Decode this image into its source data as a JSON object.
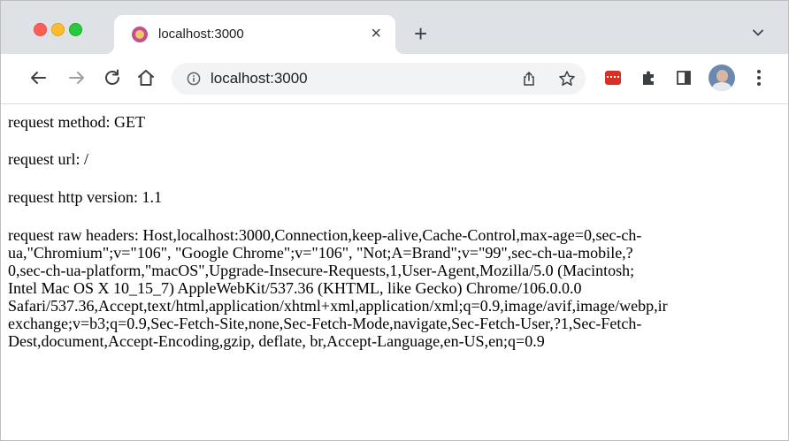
{
  "window": {
    "traffic_lights": [
      "close",
      "minimize",
      "maximize"
    ]
  },
  "tab": {
    "title": "localhost:3000",
    "favicon": "node-favicon-icon",
    "close_glyph": "×"
  },
  "tabstrip": {
    "new_tab_glyph": "+"
  },
  "toolbar": {
    "url": "localhost:3000",
    "icons": [
      "back-icon",
      "forward-icon",
      "reload-icon",
      "home-icon",
      "info-icon",
      "share-icon",
      "star-icon",
      "extension-icon",
      "puzzle-icon",
      "side-panel-icon",
      "profile-avatar",
      "menu-icon"
    ]
  },
  "page": {
    "lines": [
      "request method: GET",
      "request url: /",
      "request http version: 1.1",
      "request raw headers: Host,localhost:3000,Connection,keep-alive,Cache-Control,max-age=0,sec-ch-",
      "ua,\"Chromium\";v=\"106\", \"Google Chrome\";v=\"106\", \"Not;A=Brand\";v=\"99\",sec-ch-ua-mobile,?",
      "0,sec-ch-ua-platform,\"macOS\",Upgrade-Insecure-Requests,1,User-Agent,Mozilla/5.0 (Macintosh;",
      "Intel Mac OS X 10_15_7) AppleWebKit/537.36 (KHTML, like Gecko) Chrome/106.0.0.0",
      "Safari/537.36,Accept,text/html,application/xhtml+xml,application/xml;q=0.9,image/avif,image/webp,ir",
      "exchange;v=b3;q=0.9,Sec-Fetch-Site,none,Sec-Fetch-Mode,navigate,Sec-Fetch-User,?1,Sec-Fetch-",
      "Dest,document,Accept-Encoding,gzip, deflate, br,Accept-Language,en-US,en;q=0.9"
    ]
  },
  "colors": {
    "tabstrip_bg": "#dee1e6",
    "omnibox_bg": "#f1f3f4",
    "close": "#fe5f57",
    "minimize": "#febc2e",
    "maximize": "#28c840",
    "extension_red": "#d93025"
  }
}
